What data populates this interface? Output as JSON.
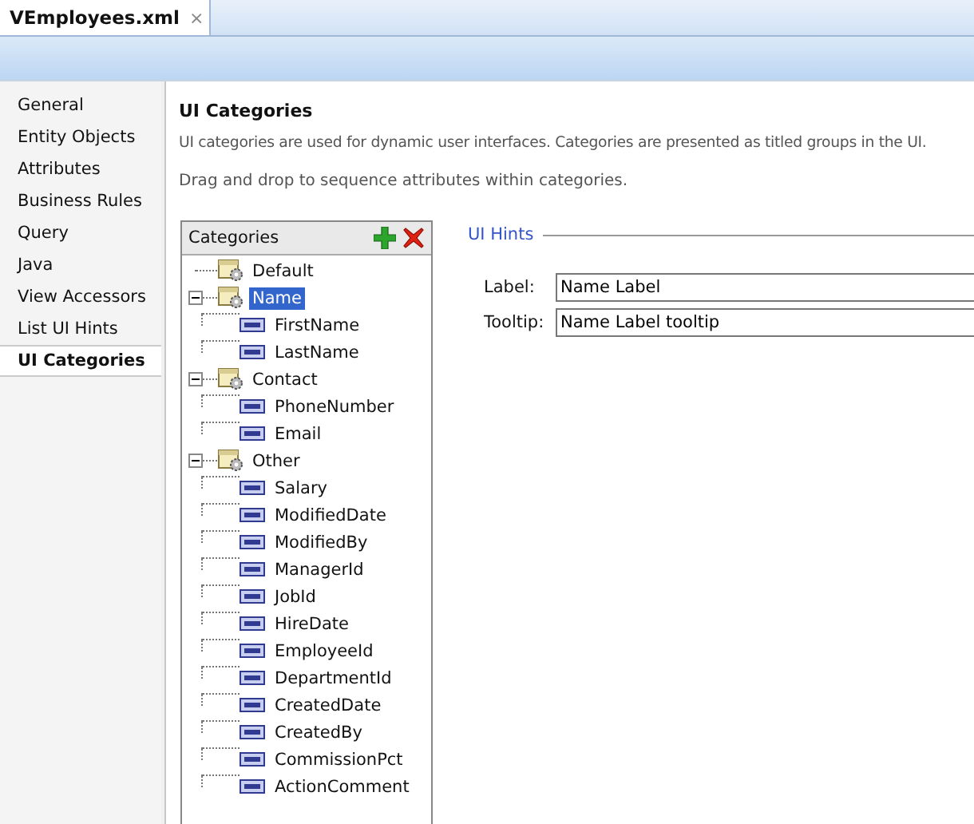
{
  "editor_tab": {
    "title": "VEmployees.xml",
    "close": "×"
  },
  "nav": [
    {
      "label": "General",
      "selected": false
    },
    {
      "label": "Entity Objects",
      "selected": false
    },
    {
      "label": "Attributes",
      "selected": false
    },
    {
      "label": "Business Rules",
      "selected": false
    },
    {
      "label": "Query",
      "selected": false
    },
    {
      "label": "Java",
      "selected": false
    },
    {
      "label": "View Accessors",
      "selected": false
    },
    {
      "label": "List UI Hints",
      "selected": false
    },
    {
      "label": "UI Categories",
      "selected": true
    }
  ],
  "page": {
    "title": "UI Categories",
    "description": "UI categories are used for dynamic user interfaces. Categories are presented as titled groups in the UI.",
    "instruction": "Drag and drop to sequence attributes within categories."
  },
  "categories": {
    "title": "Categories",
    "tree": [
      {
        "kind": "category",
        "label": "Default",
        "selected": false
      },
      {
        "kind": "category",
        "label": "Name",
        "selected": true,
        "expanded": true,
        "children": [
          {
            "kind": "attribute",
            "label": "FirstName",
            "selected": false
          },
          {
            "kind": "attribute",
            "label": "LastName",
            "selected": false
          }
        ]
      },
      {
        "kind": "category",
        "label": "Contact",
        "selected": false,
        "expanded": true,
        "children": [
          {
            "kind": "attribute",
            "label": "PhoneNumber",
            "selected": false
          },
          {
            "kind": "attribute",
            "label": "Email",
            "selected": false
          }
        ]
      },
      {
        "kind": "category",
        "label": "Other",
        "selected": false,
        "expanded": true,
        "children": [
          {
            "kind": "attribute",
            "label": "Salary",
            "selected": false
          },
          {
            "kind": "attribute",
            "label": "ModifiedDate",
            "selected": false
          },
          {
            "kind": "attribute",
            "label": "ModifiedBy",
            "selected": false
          },
          {
            "kind": "attribute",
            "label": "ManagerId",
            "selected": false
          },
          {
            "kind": "attribute",
            "label": "JobId",
            "selected": false
          },
          {
            "kind": "attribute",
            "label": "HireDate",
            "selected": false
          },
          {
            "kind": "attribute",
            "label": "EmployeeId",
            "selected": false
          },
          {
            "kind": "attribute",
            "label": "DepartmentId",
            "selected": false
          },
          {
            "kind": "attribute",
            "label": "CreatedDate",
            "selected": false
          },
          {
            "kind": "attribute",
            "label": "CreatedBy",
            "selected": false
          },
          {
            "kind": "attribute",
            "label": "CommissionPct",
            "selected": false
          },
          {
            "kind": "attribute",
            "label": "ActionComment",
            "selected": false
          }
        ]
      }
    ]
  },
  "ui_hints": {
    "title": "UI Hints",
    "fields": [
      {
        "label": "Label:",
        "value": "Name Label"
      },
      {
        "label": "Tooltip:",
        "value": "Name Label tooltip"
      }
    ]
  }
}
